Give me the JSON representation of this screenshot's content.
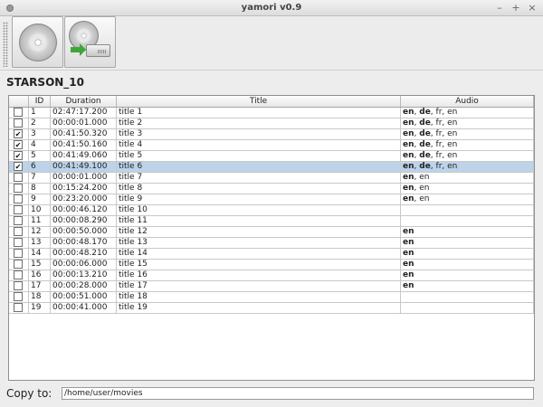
{
  "window": {
    "title": "yamori v0.9",
    "buttons": {
      "minimize": "–",
      "maximize": "+",
      "close": "×"
    }
  },
  "toolbar": {
    "buttons": [
      {
        "icon": "disc-icon"
      },
      {
        "icon": "rip-to-drive-icon"
      }
    ]
  },
  "disc": {
    "name": "STARSON_10"
  },
  "table": {
    "columns": [
      "ID",
      "Duration",
      "Title",
      "Audio"
    ],
    "rows": [
      {
        "checked": false,
        "id": "1",
        "duration": "02:47:17.200",
        "title": "title 1",
        "audio": [
          [
            "en",
            true
          ],
          [
            "de",
            true
          ],
          [
            "fr",
            false
          ],
          [
            "en",
            false
          ]
        ]
      },
      {
        "checked": false,
        "id": "2",
        "duration": "00:00:01.000",
        "title": "title 2",
        "audio": [
          [
            "en",
            true
          ],
          [
            "de",
            true
          ],
          [
            "fr",
            false
          ],
          [
            "en",
            false
          ]
        ]
      },
      {
        "checked": true,
        "id": "3",
        "duration": "00:41:50.320",
        "title": "title 3",
        "audio": [
          [
            "en",
            true
          ],
          [
            "de",
            true
          ],
          [
            "fr",
            false
          ],
          [
            "en",
            false
          ]
        ]
      },
      {
        "checked": true,
        "id": "4",
        "duration": "00:41:50.160",
        "title": "title 4",
        "audio": [
          [
            "en",
            true
          ],
          [
            "de",
            true
          ],
          [
            "fr",
            false
          ],
          [
            "en",
            false
          ]
        ]
      },
      {
        "checked": true,
        "id": "5",
        "duration": "00:41:49.060",
        "title": "title 5",
        "audio": [
          [
            "en",
            true
          ],
          [
            "de",
            true
          ],
          [
            "fr",
            false
          ],
          [
            "en",
            false
          ]
        ]
      },
      {
        "checked": true,
        "id": "6",
        "duration": "00:41:49.100",
        "title": "title 6",
        "audio": [
          [
            "en",
            true
          ],
          [
            "de",
            true
          ],
          [
            "fr",
            false
          ],
          [
            "en",
            false
          ]
        ],
        "selected": true
      },
      {
        "checked": false,
        "id": "7",
        "duration": "00:00:01.000",
        "title": "title 7",
        "audio": [
          [
            "en",
            true
          ],
          [
            "en",
            false
          ]
        ]
      },
      {
        "checked": false,
        "id": "8",
        "duration": "00:15:24.200",
        "title": "title 8",
        "audio": [
          [
            "en",
            true
          ],
          [
            "en",
            false
          ]
        ]
      },
      {
        "checked": false,
        "id": "9",
        "duration": "00:23:20.000",
        "title": "title 9",
        "audio": [
          [
            "en",
            true
          ],
          [
            "en",
            false
          ]
        ]
      },
      {
        "checked": false,
        "id": "10",
        "duration": "00:00:46.120",
        "title": "title 10",
        "audio": []
      },
      {
        "checked": false,
        "id": "11",
        "duration": "00:00:08.290",
        "title": "title 11",
        "audio": []
      },
      {
        "checked": false,
        "id": "12",
        "duration": "00:00:50.000",
        "title": "title 12",
        "audio": [
          [
            "en",
            true
          ]
        ]
      },
      {
        "checked": false,
        "id": "13",
        "duration": "00:00:48.170",
        "title": "title 13",
        "audio": [
          [
            "en",
            true
          ]
        ]
      },
      {
        "checked": false,
        "id": "14",
        "duration": "00:00:48.210",
        "title": "title 14",
        "audio": [
          [
            "en",
            true
          ]
        ]
      },
      {
        "checked": false,
        "id": "15",
        "duration": "00:00:06.000",
        "title": "title 15",
        "audio": [
          [
            "en",
            true
          ]
        ]
      },
      {
        "checked": false,
        "id": "16",
        "duration": "00:00:13.210",
        "title": "title 16",
        "audio": [
          [
            "en",
            true
          ]
        ]
      },
      {
        "checked": false,
        "id": "17",
        "duration": "00:00:28.000",
        "title": "title 17",
        "audio": [
          [
            "en",
            true
          ]
        ]
      },
      {
        "checked": false,
        "id": "18",
        "duration": "00:00:51.000",
        "title": "title 18",
        "audio": []
      },
      {
        "checked": false,
        "id": "19",
        "duration": "00:00:41.000",
        "title": "title 19",
        "audio": []
      }
    ]
  },
  "copy_to": {
    "label": "Copy to:",
    "value": "/home/user/movies"
  }
}
